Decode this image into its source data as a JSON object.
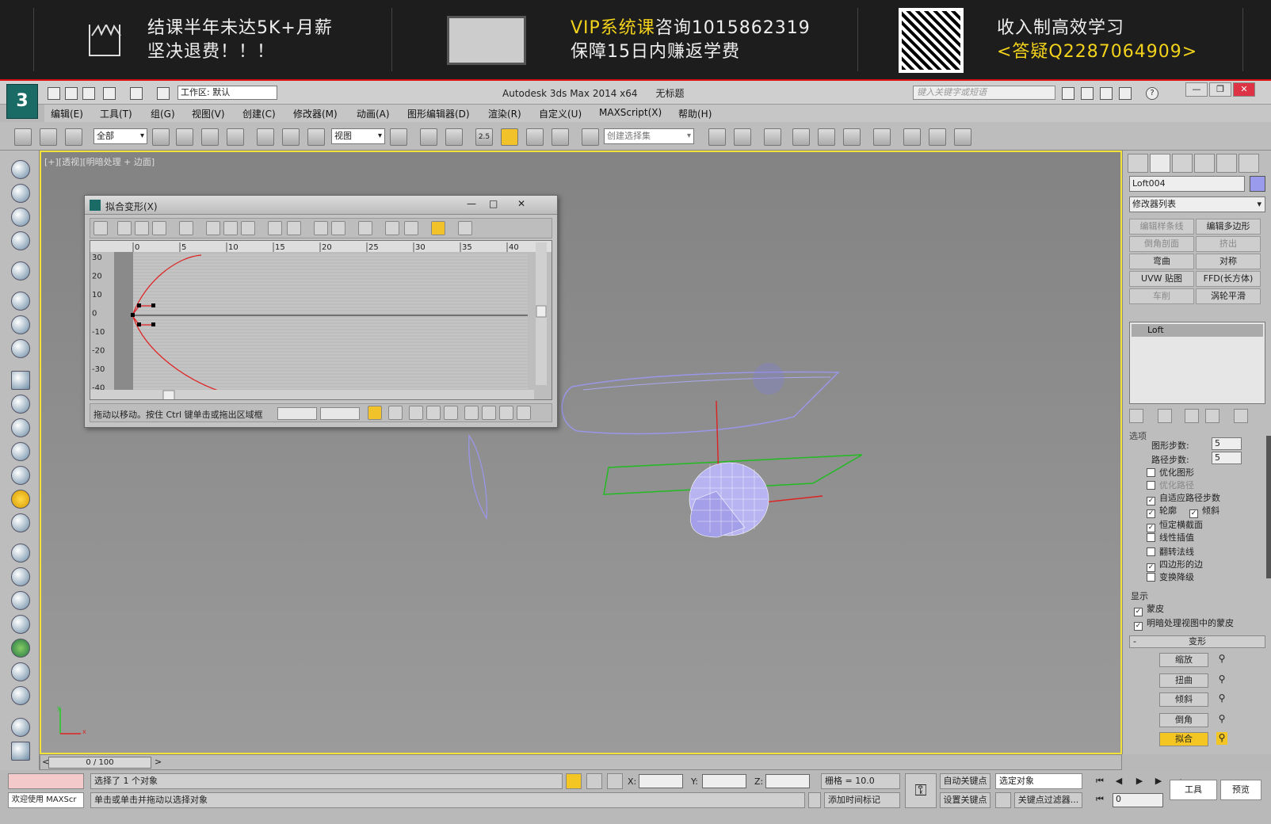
{
  "banner": {
    "left_line1": "结课半年未达5K+月薪",
    "left_line2": "坚决退费！！！",
    "vip": "VIP系统课",
    "vip_rest": "咨询1015862319",
    "guarantee": "保障15日内赚返学费",
    "right_line1": "收入制高效学习",
    "right_line2": "<答疑Q2287064909>",
    "icons": [
      "crown-icon",
      "monitor-icon",
      "qr-code"
    ]
  },
  "titlebar": {
    "workspace": "工作区: 默认",
    "title": "Autodesk 3ds Max  2014 x64",
    "doc": "无标题",
    "search_placeholder": "键入关键字或短语",
    "win_min": "—",
    "win_max": "❐",
    "win_close": "✕",
    "help": "?"
  },
  "menu": [
    "编辑(E)",
    "工具(T)",
    "组(G)",
    "视图(V)",
    "创建(C)",
    "修改器(M)",
    "动画(A)",
    "图形编辑器(D)",
    "渲染(R)",
    "自定义(U)",
    "MAXScript(X)",
    "帮助(H)"
  ],
  "toolbar": {
    "filter": "全部",
    "coord": "视图",
    "selection_set": "创建选择集",
    "snap_value": "2.5"
  },
  "viewport": {
    "label": "[+][透视][明暗处理 + 边面]",
    "accent": "#f4e23a"
  },
  "dialog": {
    "title": "拟合变形(X)",
    "ruler": [
      "0",
      "5",
      "10",
      "15",
      "20",
      "25",
      "30",
      "35",
      "40"
    ],
    "yticks": [
      "30",
      "20",
      "10",
      "0",
      "-10",
      "-20",
      "-30",
      "-40"
    ],
    "status_msg": "拖动以移动。按住 Ctrl 键单击或拖出区域框",
    "curve_color": "#e02020"
  },
  "cmdpanel": {
    "object_name": "Loft004",
    "object_color": "#9b9bee",
    "modifier_list": "修改器列表",
    "buttons": [
      {
        "label": "编辑样条线",
        "enabled": false
      },
      {
        "label": "编辑多边形",
        "enabled": true
      },
      {
        "label": "倒角剖面",
        "enabled": false
      },
      {
        "label": "挤出",
        "enabled": false
      },
      {
        "label": "弯曲",
        "enabled": true
      },
      {
        "label": "对称",
        "enabled": true
      },
      {
        "label": "UVW 贴图",
        "enabled": true
      },
      {
        "label": "FFD(长方体)",
        "enabled": true
      },
      {
        "label": "车削",
        "enabled": false
      },
      {
        "label": "涡轮平滑",
        "enabled": true
      }
    ],
    "stack_item": "Loft",
    "rollout_skin": "选项",
    "shape_steps_label": "图形步数:",
    "shape_steps": "5",
    "path_steps_label": "路径步数:",
    "path_steps": "5",
    "options": [
      {
        "label": "优化图形",
        "checked": false
      },
      {
        "label": "优化路径",
        "checked": false
      },
      {
        "label": "自适应路径步数",
        "checked": true
      },
      {
        "label": "轮廓",
        "checked": true
      },
      {
        "label": "倾斜",
        "checked": true
      },
      {
        "label": "恒定横截面",
        "checked": true
      },
      {
        "label": "线性插值",
        "checked": false
      },
      {
        "label": "翻转法线",
        "checked": false
      },
      {
        "label": "四边形的边",
        "checked": true
      },
      {
        "label": "变换降级",
        "checked": false
      }
    ],
    "display_title": "显示",
    "display": [
      {
        "label": "蒙皮",
        "checked": true
      },
      {
        "label": "明暗处理视图中的蒙皮",
        "checked": true
      }
    ],
    "deform_title": "变形",
    "deform_collapse": "-",
    "deform": [
      {
        "label": "缩放",
        "active": false
      },
      {
        "label": "扭曲",
        "active": false
      },
      {
        "label": "倾斜",
        "active": false
      },
      {
        "label": "倒角",
        "active": false
      },
      {
        "label": "拟合",
        "active": true
      }
    ],
    "active_accent": "#f3c623"
  },
  "timeline": {
    "frame": "0 / 100",
    "prev": "<",
    "next": ">"
  },
  "status": {
    "maxscript": "欢迎使用 MAXScr",
    "selected": "选择了 1 个对象",
    "prompt": "单击或单击并拖动以选择对象",
    "x_label": "X:",
    "y_label": "Y:",
    "z_label": "Z:",
    "grid": "栅格 = 10.0",
    "add_time_tag": "添加时间标记",
    "auto_key": "自动关键点",
    "set_key": "设置关键点",
    "selected_object": "选定对象",
    "key_filter": "关键点过滤器...",
    "frame_field": "0",
    "tools": "工具",
    "preview": "预览"
  }
}
